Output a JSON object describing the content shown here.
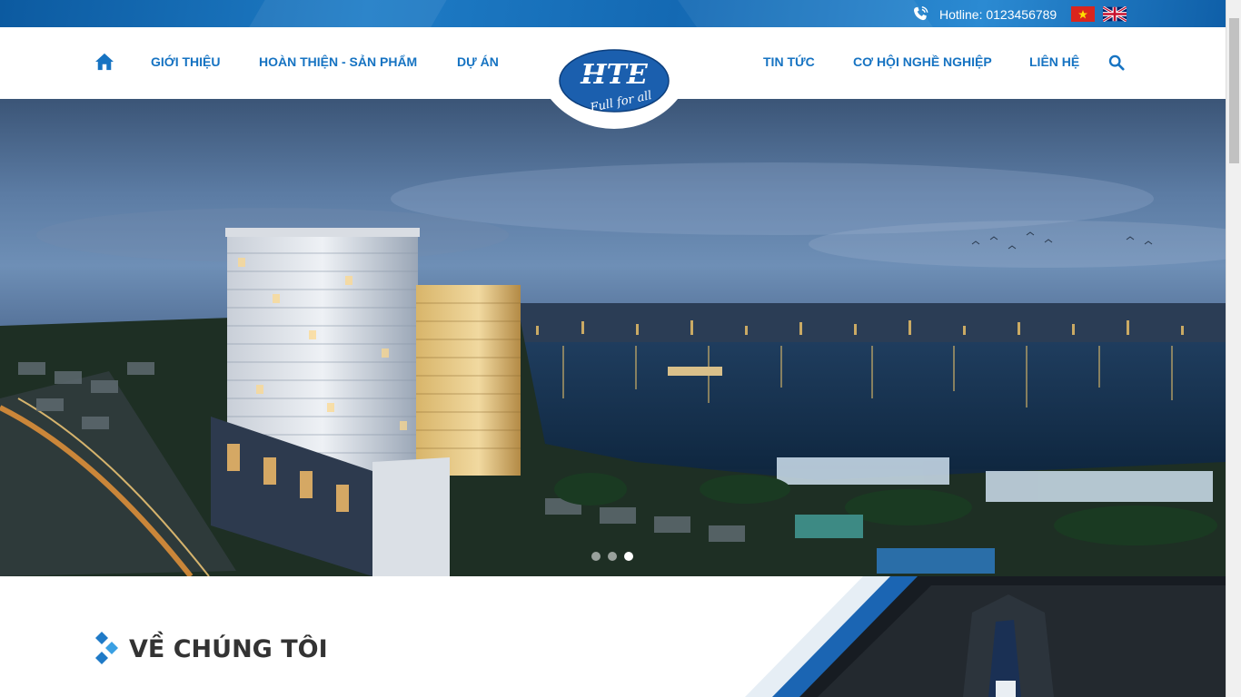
{
  "topbar": {
    "hotline": "Hotline: 0123456789",
    "languages": [
      "vi",
      "en"
    ]
  },
  "nav": {
    "left": [
      "GIỚI THIỆU",
      "HOÀN THIỆN - SẢN PHẨM",
      "DỰ ÁN"
    ],
    "right": [
      "TIN TỨC",
      "CƠ HỘI NGHỀ NGHIỆP",
      "LIÊN HỆ"
    ]
  },
  "logo": {
    "mark": "HTE",
    "tagline": "Full for all"
  },
  "slider": {
    "slide_count": 3,
    "active_index": 2
  },
  "about": {
    "title": "VỀ CHÚNG TÔI"
  },
  "colors": {
    "primary": "#1673c2",
    "topbar": "#1469b3",
    "heading": "#333333"
  },
  "icons": [
    "home-icon",
    "search-icon",
    "phone-icon",
    "diamond-icon"
  ]
}
